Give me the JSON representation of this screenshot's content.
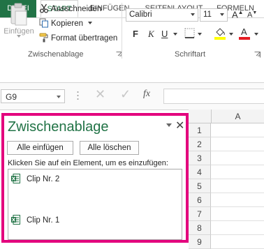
{
  "tabs": {
    "file": "DATEI",
    "start": "START",
    "insert": "EINFÜGEN",
    "layout": "SEITENLAYOUT",
    "formulas": "FORMELN"
  },
  "clipboard_group": {
    "paste_label": "Einfügen",
    "cut_label": "Ausschneiden",
    "copy_label": "Kopieren",
    "format_painter_label": "Format übertragen",
    "group_label": "Zwischenablage"
  },
  "font_group": {
    "font_name": "Calibri",
    "font_size": "11",
    "grow_label": "A",
    "shrink_label": "A",
    "bold_label": "F",
    "italic_label": "K",
    "underline_label": "U",
    "group_label": "Schriftart",
    "fill_color": "#ffff00",
    "font_color": "#e51c23"
  },
  "formula_bar": {
    "name_box": "G9",
    "fx_label": "fx",
    "formula_value": ""
  },
  "grid": {
    "column_header": "A",
    "row_headers": [
      "1",
      "2",
      "3",
      "4",
      "5",
      "6",
      "7",
      "8",
      "9"
    ]
  },
  "clipboard_pane": {
    "title": "Zwischenablage",
    "paste_all_label": "Alle einfügen",
    "clear_all_label": "Alle löschen",
    "instruction": "Klicken Sie auf ein Element, um es einzufügen:",
    "items": [
      {
        "label": "Clip Nr. 2",
        "icon": "excel-icon"
      },
      {
        "label": "Clip Nr. 1",
        "icon": "excel-icon"
      }
    ],
    "highlight_color": "#e3007d",
    "accent_color": "#217346"
  }
}
